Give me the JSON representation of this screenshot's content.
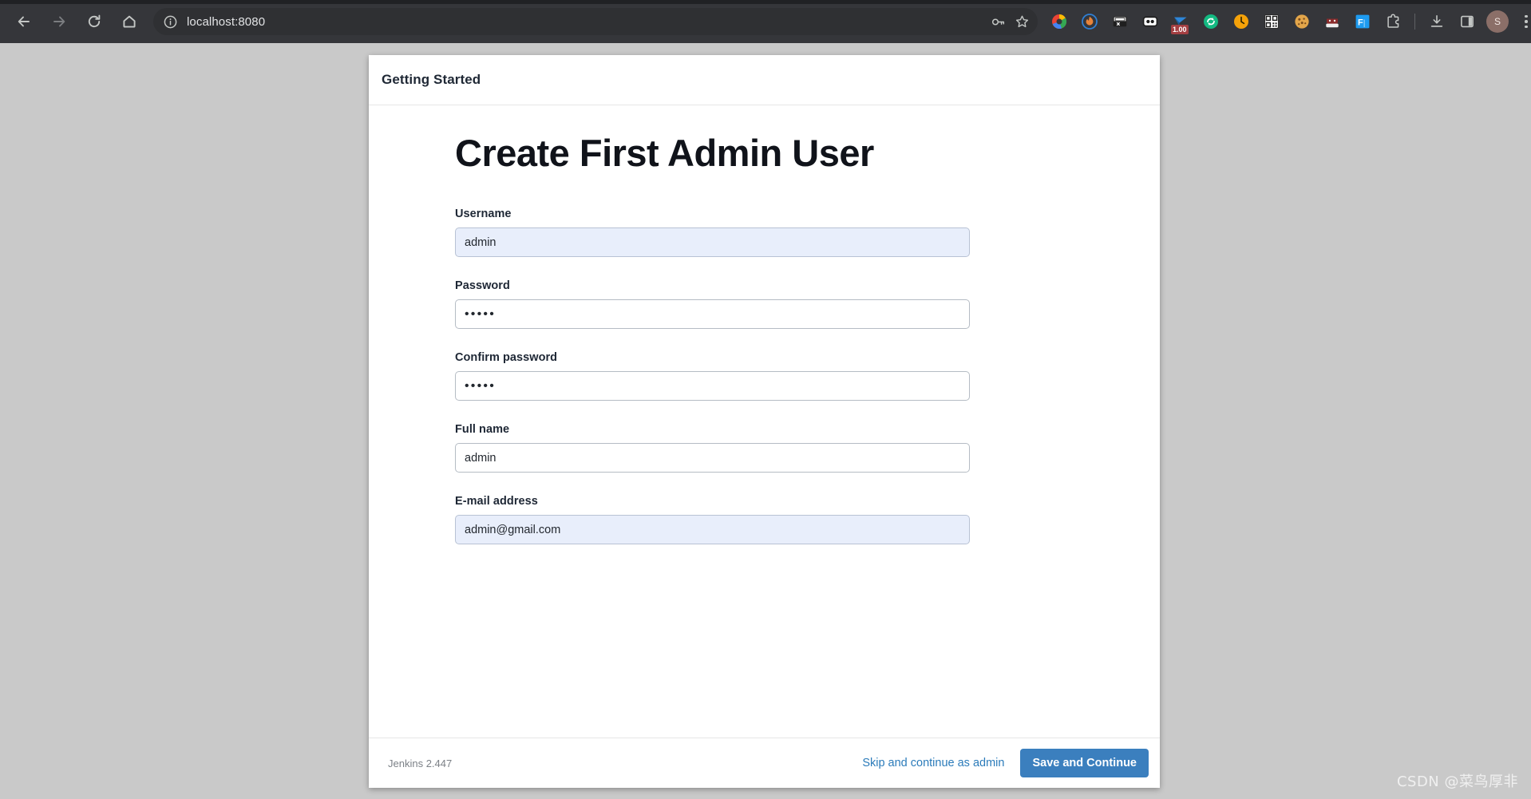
{
  "browser": {
    "nav": {
      "back_label": "Back",
      "forward_label": "Forward",
      "reload_label": "Reload",
      "home_label": "Home"
    },
    "omnibox": {
      "url": "localhost:8080",
      "site_info_icon": "info-circle-icon",
      "save_password_icon": "key-icon",
      "bookmark_icon": "star-icon"
    },
    "extensions": [
      {
        "name": "google-colorful-ring-extension",
        "icon": "colorful-ring-icon"
      },
      {
        "name": "blue-circle-flame-extension",
        "icon": "flame-circle-icon"
      },
      {
        "name": "excel-export-extension",
        "icon": "spreadsheet-print-icon"
      },
      {
        "name": "ghost-face-extension",
        "icon": "ghost-face-icon"
      },
      {
        "name": "currency-rate-extension",
        "icon": "paper-plane-icon",
        "badge": "1.00"
      },
      {
        "name": "sync-refresh-extension",
        "icon": "refresh-circle-icon"
      },
      {
        "name": "clock-timer-extension",
        "icon": "clock-icon"
      },
      {
        "name": "qr-code-extension",
        "icon": "qr-code-icon"
      },
      {
        "name": "cookie-editor-extension",
        "icon": "cookie-icon"
      },
      {
        "name": "privacy-mask-extension",
        "icon": "mask-icon"
      },
      {
        "name": "fehelper-extension",
        "icon": "fh-square-icon"
      },
      {
        "name": "extensions-puzzle",
        "icon": "puzzle-piece-icon"
      }
    ],
    "toolbar_right": {
      "downloads_icon": "download-icon",
      "side_panel_icon": "side-panel-icon",
      "profile_initial": "S",
      "menu_icon": "kebab-menu-icon"
    }
  },
  "card": {
    "header_title": "Getting Started",
    "heading": "Create First Admin User",
    "fields": [
      {
        "label": "Username",
        "value": "admin",
        "type": "text",
        "autofilled": true,
        "name": "username"
      },
      {
        "label": "Password",
        "value": "•••••",
        "type": "password",
        "autofilled": false,
        "name": "password"
      },
      {
        "label": "Confirm password",
        "value": "•••••",
        "type": "password",
        "autofilled": false,
        "name": "confirm-password"
      },
      {
        "label": "Full name",
        "value": "admin",
        "type": "text",
        "autofilled": false,
        "name": "full-name"
      },
      {
        "label": "E-mail address",
        "value": "admin@gmail.com",
        "type": "text",
        "autofilled": true,
        "name": "email"
      }
    ],
    "footer": {
      "version": "Jenkins 2.447",
      "skip_label": "Skip and continue as admin",
      "save_label": "Save and Continue"
    }
  },
  "watermark": "CSDN @菜鸟厚非",
  "colors": {
    "chrome_bg": "#35363a",
    "omnibox_bg": "#2f3033",
    "page_bg": "#c9c9c9",
    "card_bg": "#ffffff",
    "accent_blue": "#3b7fbe",
    "link_blue": "#2b7bba",
    "autofill_blue": "#e8eefb",
    "heading": "#10131a",
    "muted_text": "#7c8187"
  }
}
